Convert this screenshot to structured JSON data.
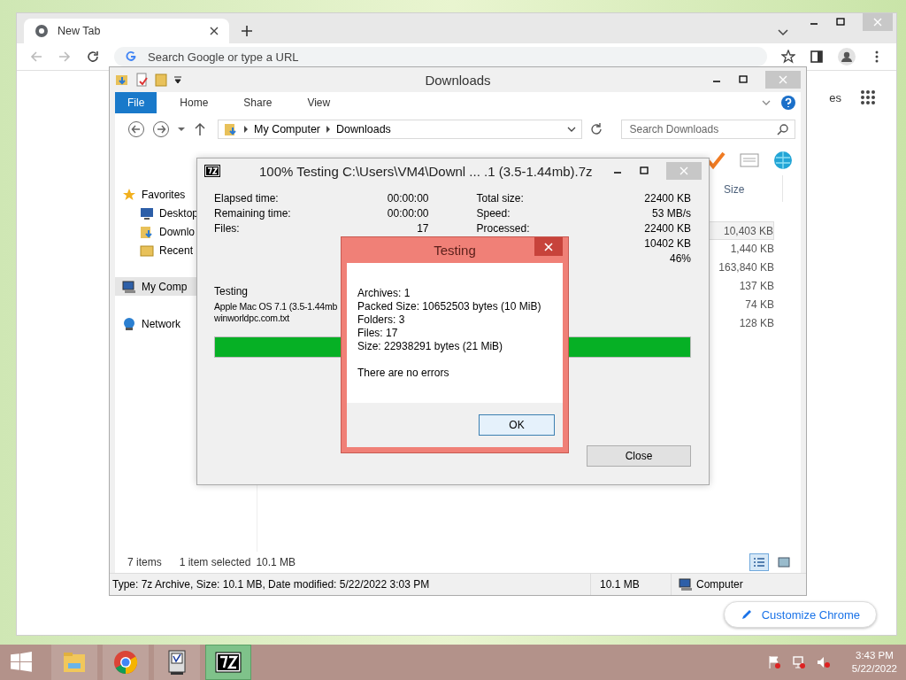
{
  "browser": {
    "tab_title": "New Tab",
    "address_placeholder": "Search Google or type a URL",
    "corner_link": "es",
    "customize_button": "Customize Chrome"
  },
  "explorer": {
    "title": "Downloads",
    "ribbon_tabs": [
      {
        "label": "File",
        "selected": true
      },
      {
        "label": "Home",
        "selected": false
      },
      {
        "label": "Share",
        "selected": false
      },
      {
        "label": "View",
        "selected": false
      }
    ],
    "breadcrumb": [
      "My Computer",
      "Downloads"
    ],
    "search_placeholder": "Search Downloads",
    "nav": [
      {
        "label": "Favorites",
        "kind": "star",
        "selected": false,
        "children": [
          {
            "label": "Desktop",
            "kind": "desktop",
            "selected": false
          },
          {
            "label": "Downlo",
            "kind": "download",
            "selected": false
          },
          {
            "label": "Recent",
            "kind": "recent",
            "selected": false
          }
        ]
      },
      {
        "label": "My Comp",
        "kind": "computer",
        "selected": true
      },
      {
        "label": "Network",
        "kind": "network",
        "selected": false
      }
    ],
    "size_header": "Size",
    "sizes": [
      {
        "text": "10,403 KB",
        "selected": true
      },
      {
        "text": "1,440 KB",
        "selected": false
      },
      {
        "text": "163,840 KB",
        "selected": false
      },
      {
        "text": "137 KB",
        "selected": false
      },
      {
        "text": "74 KB",
        "selected": false
      },
      {
        "text": "128 KB",
        "selected": false
      }
    ],
    "item_count": "7 items",
    "selection": "1 item selected",
    "selection_size": "10.1 MB",
    "views": [
      {
        "kind": "details",
        "selected": true
      },
      {
        "kind": "large",
        "selected": false
      }
    ],
    "details_bar": {
      "description": "Type: 7z Archive, Size: 10.1 MB, Date modified: 5/22/2022 3:03 PM",
      "size": "10.1 MB",
      "location": "Computer"
    }
  },
  "progress_window": {
    "title": "100% Testing C:\\Users\\VM4\\Downl ... .1 (3.5-1.44mb).7z",
    "stats_left": [
      {
        "label": "Elapsed time:",
        "value": "00:00:00"
      },
      {
        "label": "Remaining time:",
        "value": "00:00:00"
      },
      {
        "label": "Files:",
        "value": "17"
      }
    ],
    "stats_right": [
      {
        "label": "Total size:",
        "value": "22400 KB"
      },
      {
        "label": "Speed:",
        "value": "53 MB/s"
      },
      {
        "label": "Processed:",
        "value": "22400 KB"
      },
      {
        "value": "10402 KB"
      },
      {
        "value": "46%"
      }
    ],
    "status": "Testing",
    "current_file": [
      "Apple Mac OS 7.1 (3.5-1.44mb",
      "winworldpc.com.txt"
    ],
    "level": 1,
    "button": "Close"
  },
  "message_box": {
    "title": "Testing",
    "lines": [
      "Archives: 1",
      "Packed Size: 10652503 bytes (10 MiB)",
      "Folders: 3",
      "Files: 17",
      "Size: 22938291 bytes (21 MiB)"
    ],
    "summary": "There are no errors",
    "button": "OK"
  },
  "taskbar": {
    "apps": [
      {
        "kind": "explorer",
        "selected": false
      },
      {
        "kind": "chrome",
        "selected": false
      },
      {
        "kind": "mac",
        "selected": false
      },
      {
        "kind": "sevenzip",
        "selected": true
      }
    ],
    "time": "3:43 PM",
    "date": "5/22/2022"
  }
}
